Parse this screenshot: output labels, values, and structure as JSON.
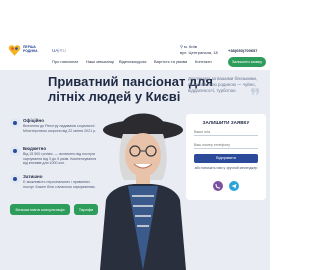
{
  "brand": {
    "name_line1": "ПЕРША",
    "name_line2": "РОДИНА",
    "accent": "#2c4a9a",
    "heart_colors": [
      "#f2b320",
      "#e84a4a",
      "#2c4a9a"
    ]
  },
  "lang": {
    "active": "UA",
    "other": "RU"
  },
  "contact": {
    "city": "м. Київ",
    "street": "вул. Центральна, 18",
    "phone": "+38(050)700657"
  },
  "menu": {
    "items": [
      "Про пансіонат",
      "Наші мешканці",
      "Відеоекскурсія",
      "Вартість та умови",
      "Контакти"
    ],
    "cta": "Залишити заявку"
  },
  "hero": {
    "title": "Приватний пансіонат для літніх людей у Києві",
    "quote": "Доглянемо за вашими близькими, як за власною родиною — чуйно, віддаленості, турботою"
  },
  "features": [
    {
      "title": "Офіційно",
      "text": "Внесення до Реєстру надавачів соціальної. Міністерством охорони від 22 квітня 2021 р."
    },
    {
      "title": "Бюджетно",
      "text": "Від 15 500 грн/міс. — включено від послуги харчування від 3 до 5 разів. Компенсування від впливів для 1000 кон."
    },
    {
      "title": "Затишно",
      "text": "Є можливість персональних і приватних послуг. Кожен біля з власною харчуванням."
    }
  ],
  "buttons": {
    "consult": "Безкоштовна консультація",
    "prices": "Тарифи"
  },
  "form": {
    "title": "ЗАЛИШИТИ ЗАЯВКУ",
    "name_placeholder": "Ваше ім'я",
    "phone_placeholder": "Ваш номер телефону",
    "submit": "Відправити",
    "note": "або напишіть нам у зручний месенджер",
    "messengers": [
      "viber",
      "telegram"
    ]
  },
  "colors": {
    "green": "#2e9d5b",
    "hero_bg": "#e9edf3",
    "viber": "#7b519d",
    "telegram": "#2aa3d9"
  }
}
